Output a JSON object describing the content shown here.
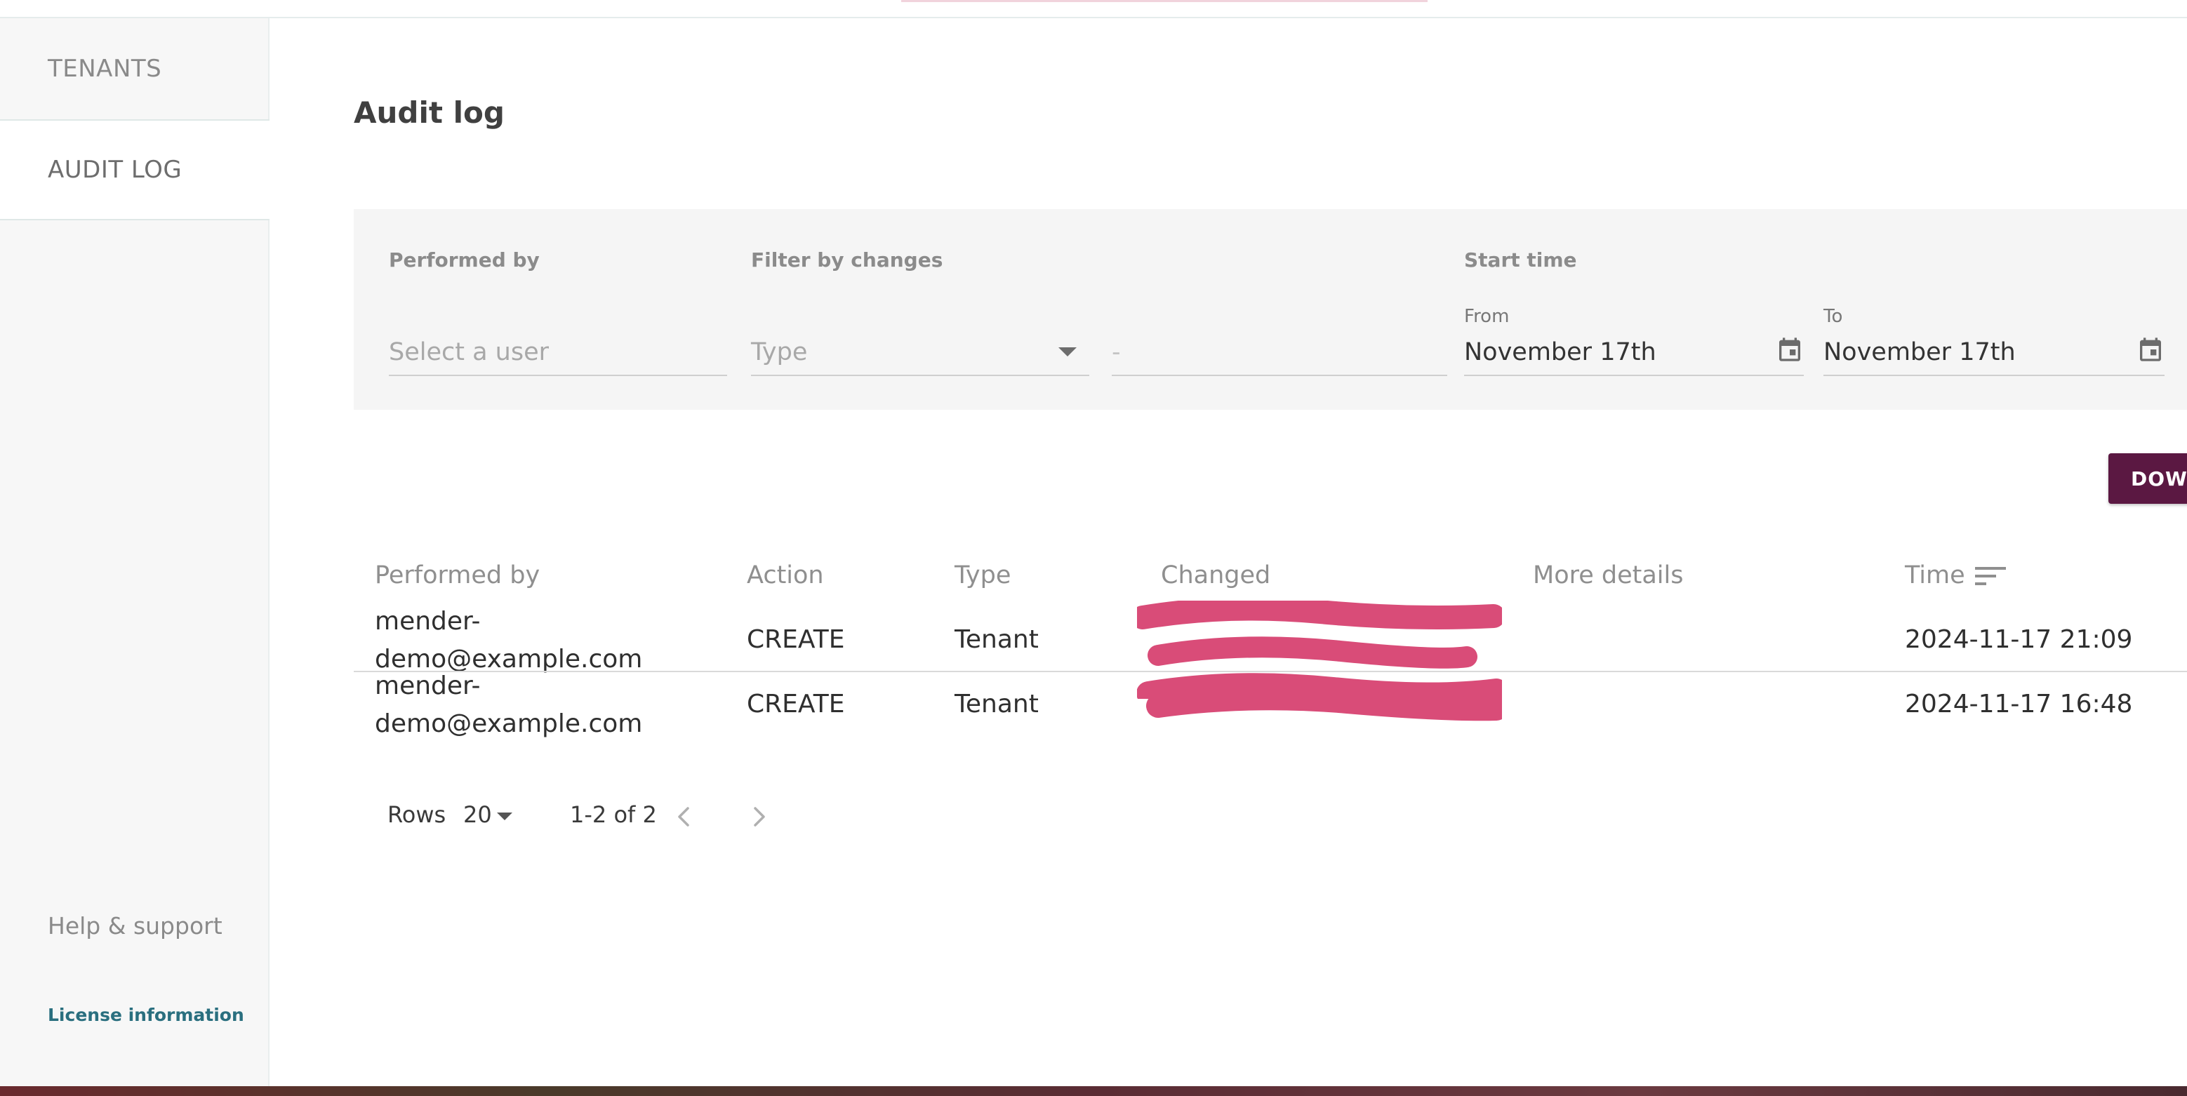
{
  "sidebar": {
    "items": [
      {
        "label": "TENANTS"
      },
      {
        "label": "AUDIT LOG"
      }
    ],
    "help_label": "Help & support",
    "license_label": "License information"
  },
  "main": {
    "title": "Audit log",
    "filters": {
      "performed_by_label": "Performed by",
      "user_placeholder": "Select a user",
      "changes_label": "Filter by changes",
      "type_placeholder": "Type",
      "detail_placeholder": "-",
      "start_time_label": "Start time",
      "from_label": "From",
      "from_value": "November 17th",
      "to_label": "To",
      "to_value": "November 17th"
    },
    "download_label": "DOWNLOAD",
    "table": {
      "headers": [
        "Performed by",
        "Action",
        "Type",
        "Changed",
        "More details",
        "Time"
      ],
      "rows": [
        {
          "user_line1": "mender-",
          "user_line2": "demo@example.com",
          "action": "CREATE",
          "type": "Tenant",
          "time": "2024-11-17 21:09"
        },
        {
          "user_line1": "mender-",
          "user_line2": "demo@example.com",
          "action": "CREATE",
          "type": "Tenant",
          "time": "2024-11-17 16:48"
        }
      ]
    },
    "pagination": {
      "rows_label": "Rows",
      "rows_per_page": "20",
      "range": "1-2 of 2"
    }
  },
  "colors": {
    "accent": "#5b1842",
    "link": "#2a6f7f",
    "redaction": "#d94c78"
  },
  "icons": {
    "calendar": "calendar-icon",
    "sort": "sort-icon",
    "dropdown": "chevron-down-icon",
    "prev": "chevron-left-icon",
    "next": "chevron-right-icon"
  }
}
